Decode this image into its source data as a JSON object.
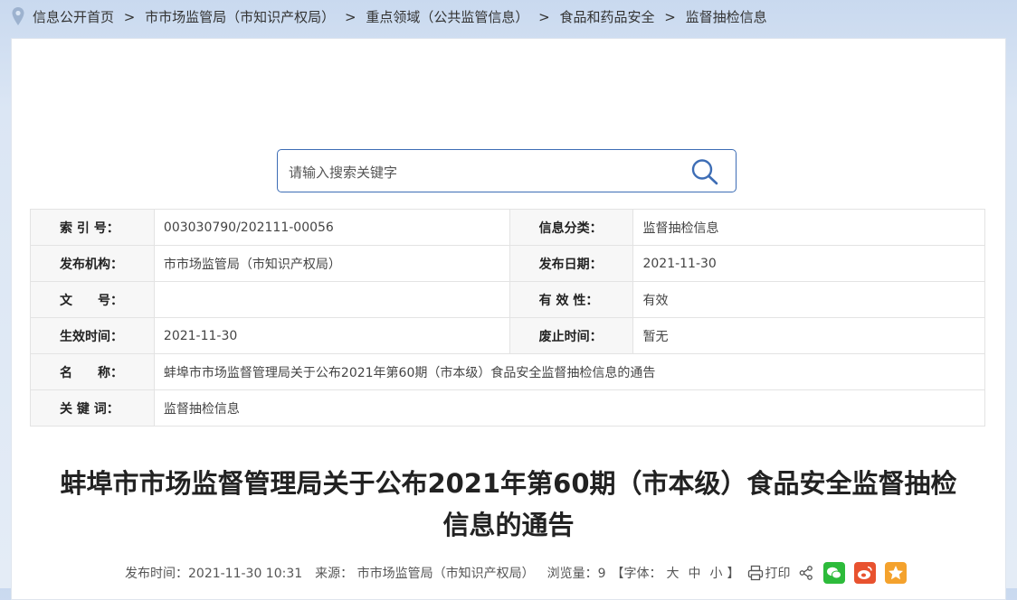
{
  "breadcrumb": {
    "items": [
      "信息公开首页",
      "市市场监管局（市知识产权局）",
      "重点领域（公共监管信息）",
      "食品和药品安全",
      "监督抽检信息"
    ],
    "separator": ">"
  },
  "search": {
    "placeholder": "请输入搜索关键字"
  },
  "meta": {
    "rows": [
      {
        "label1": "索 引 号：",
        "value1": "003030790/202111-00056",
        "label2": "信息分类：",
        "value2": "监督抽检信息"
      },
      {
        "label1": "发布机构：",
        "value1": "市市场监管局（市知识产权局）",
        "label2": "发布日期：",
        "value2": "2021-11-30"
      },
      {
        "label1": "文　　号：",
        "value1": "",
        "label2": "有 效 性：",
        "value2": "有效"
      },
      {
        "label1": "生效时间：",
        "value1": "2021-11-30",
        "label2": "废止时间：",
        "value2": "暂无"
      }
    ],
    "name_label": "名　　称：",
    "name_value": "蚌埠市市场监督管理局关于公布2021年第60期（市本级）食品安全监督抽检信息的通告",
    "keyword_label": "关 键 词：",
    "keyword_value": "监督抽检信息"
  },
  "article": {
    "title_line1": "蚌埠市市场监督管理局关于公布2021年第60期（市本级）食品安全监督抽检",
    "title_line2": "信息的通告"
  },
  "info": {
    "publish_time": "发布时间：2021-11-30 10:31",
    "source": "来源： 市市场监管局（市知识产权局）",
    "views": "浏览量：9",
    "font_label": "【字体：",
    "font_large": "大",
    "font_medium": "中",
    "font_small": "小",
    "font_end": "】",
    "print": "打印"
  },
  "colors": {
    "accent": "#3d6db5",
    "wechat": "#2dbb3b",
    "weibo": "#e8522f",
    "favorite": "#f4a22d"
  }
}
